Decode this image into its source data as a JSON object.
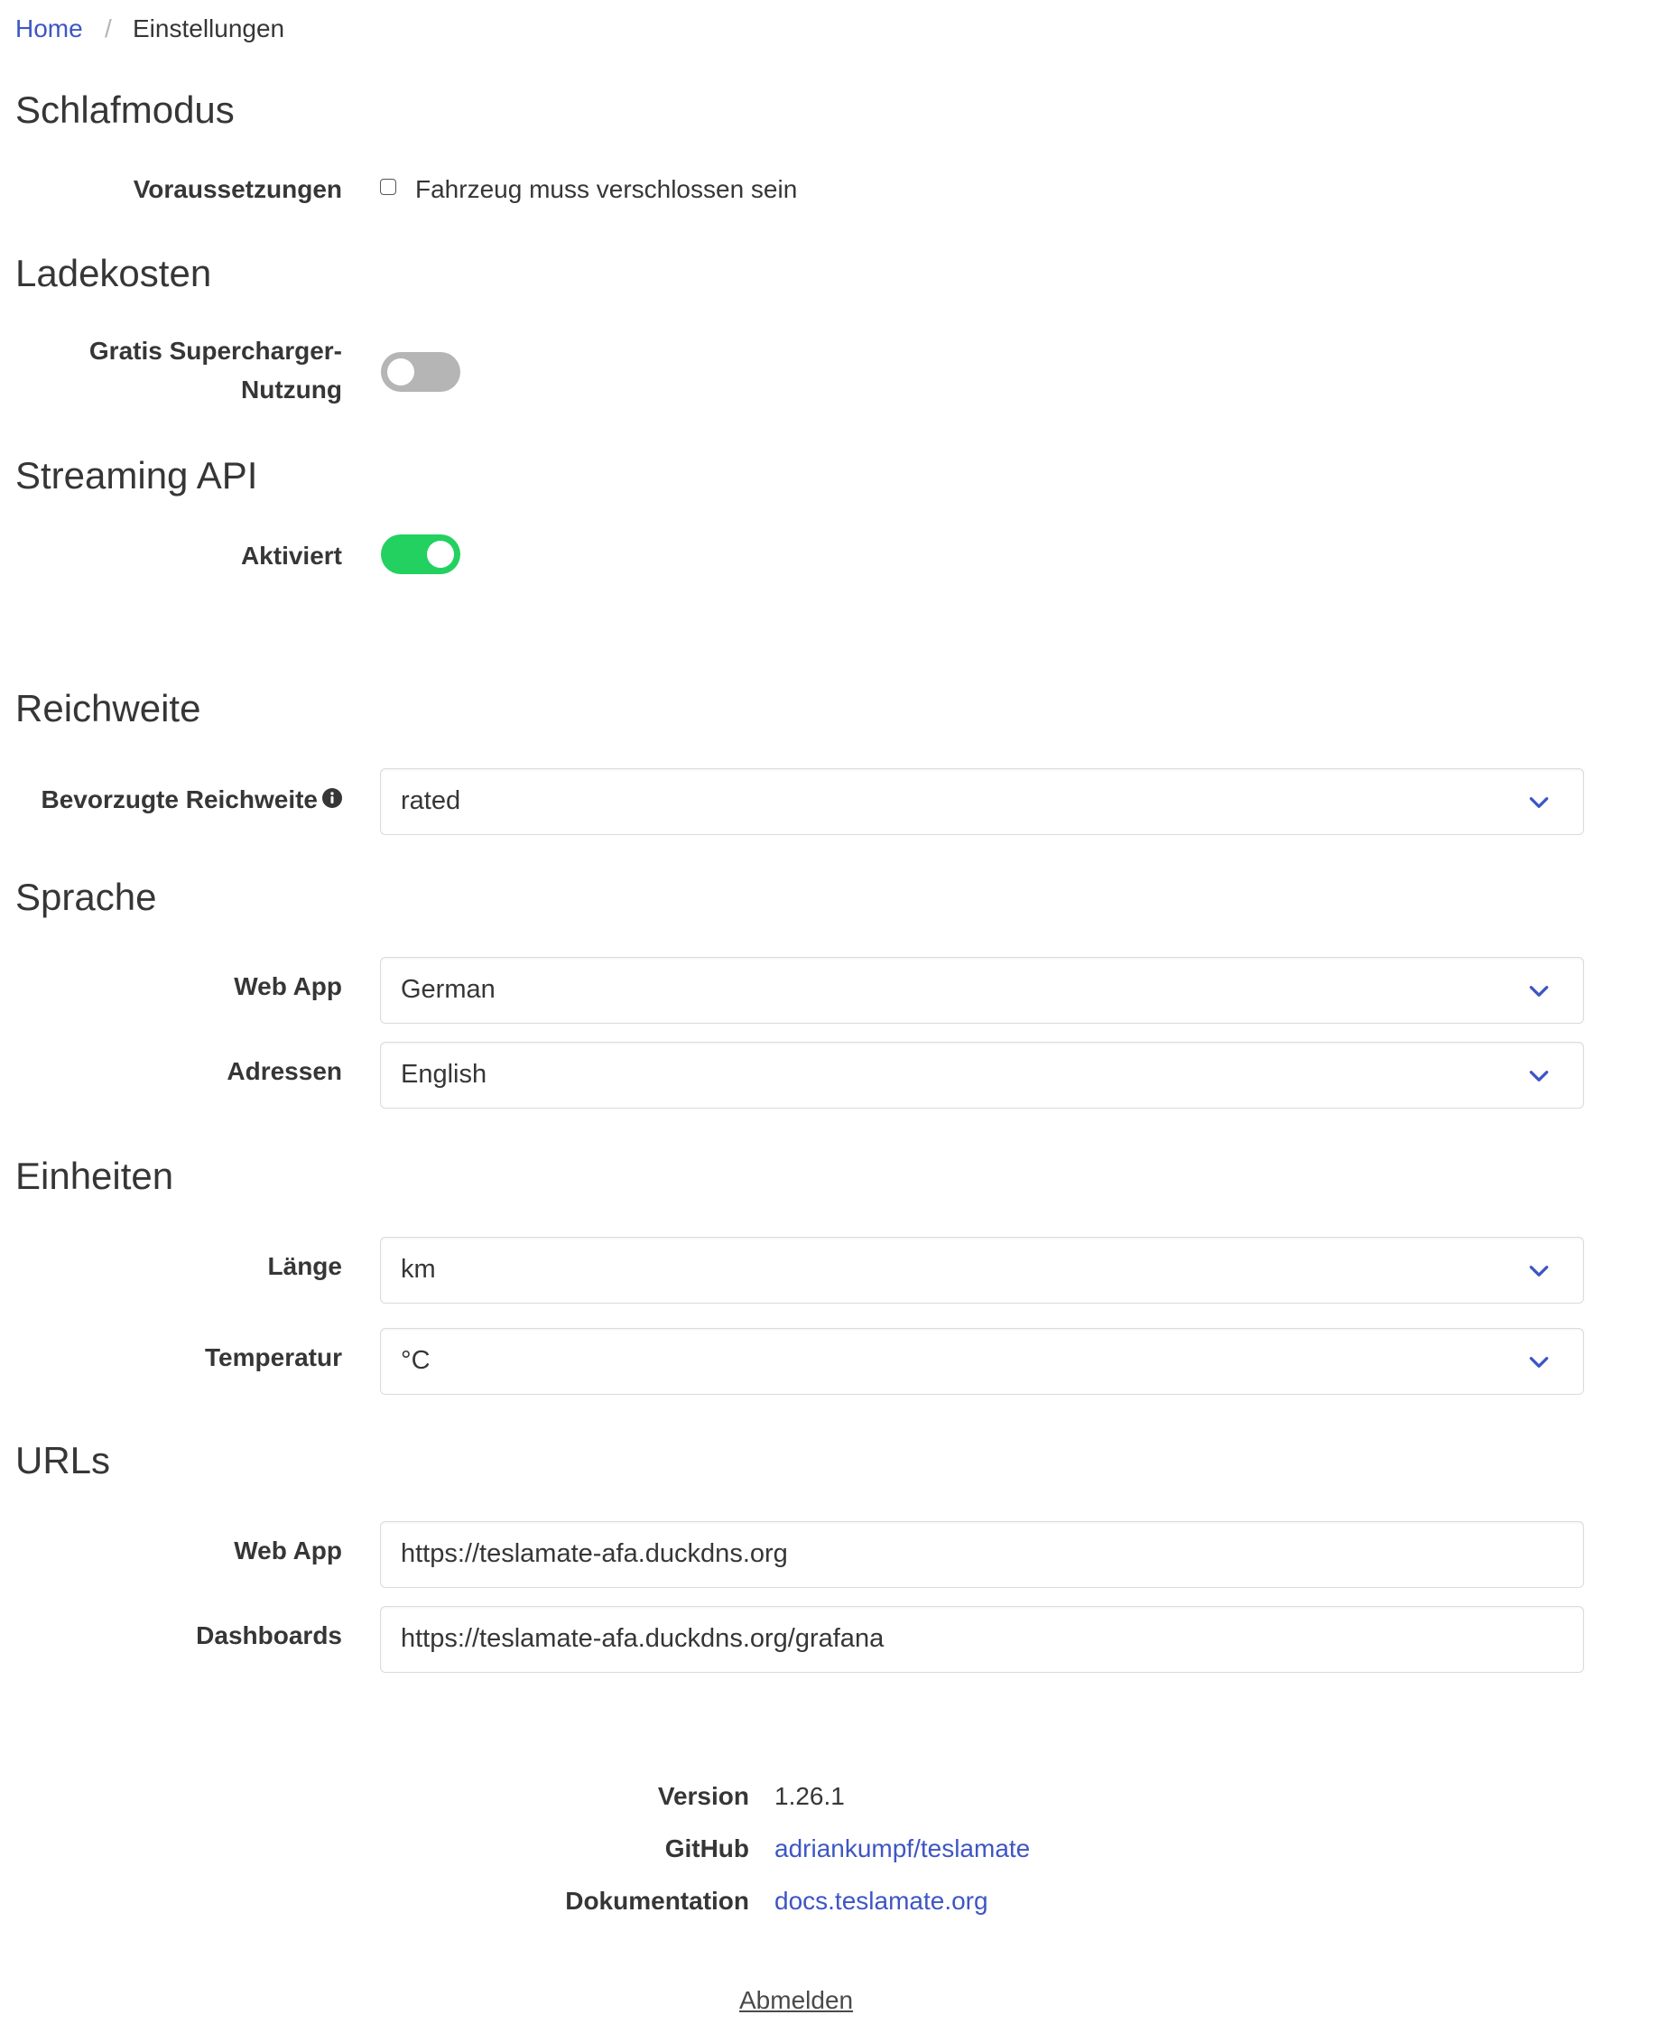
{
  "breadcrumb": {
    "home": "Home",
    "separator": "/",
    "current": "Einstellungen"
  },
  "sleep_mode": {
    "heading": "Schlafmodus",
    "requirements_label": "Voraussetzungen",
    "checkbox_label": "Fahrzeug muss verschlossen sein",
    "checkbox_checked": false
  },
  "charge_cost": {
    "heading": "Ladekosten",
    "free_supercharging_label_line1": "Gratis Supercharger-",
    "free_supercharging_label_line2": "Nutzung",
    "free_supercharging_enabled": false
  },
  "streaming": {
    "heading": "Streaming API",
    "enabled_label": "Aktiviert",
    "enabled": true
  },
  "range": {
    "heading": "Reichweite",
    "preferred_label": "Bevorzugte Reichweite",
    "preferred_value": "rated"
  },
  "language": {
    "heading": "Sprache",
    "web_app_label": "Web App",
    "web_app_value": "German",
    "addresses_label": "Adressen",
    "addresses_value": "English"
  },
  "units": {
    "heading": "Einheiten",
    "length_label": "Länge",
    "length_value": "km",
    "temperature_label": "Temperatur",
    "temperature_value": "°C"
  },
  "urls": {
    "heading": "URLs",
    "web_app_label": "Web App",
    "web_app_value": "https://teslamate-afa.duckdns.org",
    "dashboards_label": "Dashboards",
    "dashboards_value": "https://teslamate-afa.duckdns.org/grafana"
  },
  "footer": {
    "version_label": "Version",
    "version_value": "1.26.1",
    "github_label": "GitHub",
    "github_value": "adriankumpf/teslamate",
    "docs_label": "Dokumentation",
    "docs_value": "docs.teslamate.org",
    "logout": "Abmelden"
  },
  "colors": {
    "link": "#3e56c4",
    "toggle_on": "#23d160",
    "toggle_off": "#b5b5b5",
    "text": "#363636"
  }
}
